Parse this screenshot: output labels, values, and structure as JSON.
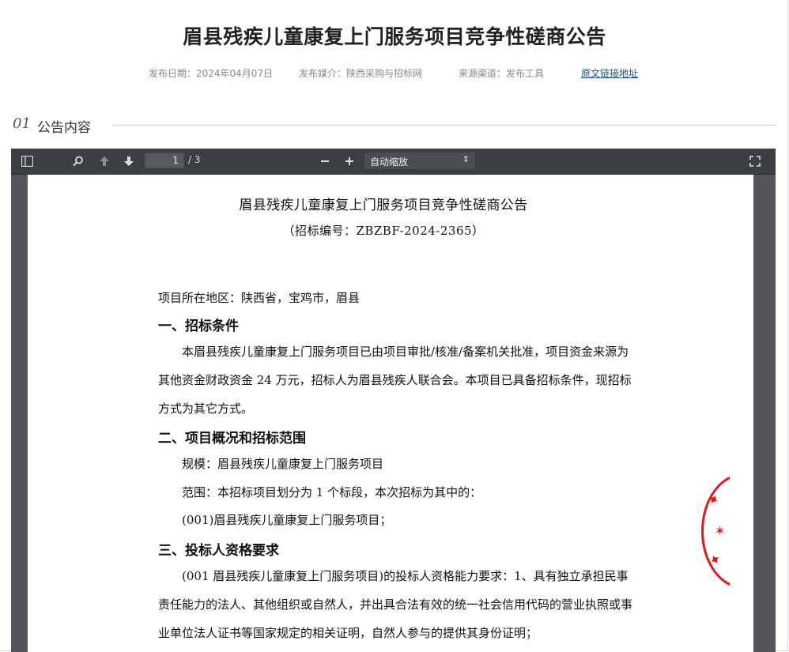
{
  "page": {
    "title": "眉县残疾儿童康复上门服务项目竞争性磋商公告",
    "meta": {
      "date": "发布日期：2024年04月07日",
      "media": "发布媒介：陕西采购与招标网",
      "source": "来源渠道：发布工具",
      "link": "原文链接地址"
    },
    "section": {
      "num": "01",
      "label": "公告内容"
    }
  },
  "viewer": {
    "page_current": "1",
    "page_total": "/ 3",
    "zoom_label": "自动缩放",
    "icons": [
      "sidebar-toggle-icon",
      "search-icon",
      "previous-page-icon",
      "next-page-icon",
      "zoom-out-icon",
      "zoom-in-icon",
      "fullscreen-icon"
    ]
  },
  "document": {
    "title": "眉县残疾儿童康复上门服务项目竞争性磋商公告",
    "subtitle": "（招标编号：ZBZBF-2024-2365）",
    "lines": [
      "项目所在地区：陕西省，宝鸡市，眉县",
      "一、招标条件",
      "本眉县残疾儿童康复上门服务项目已由项目审批/核准/备案机关批准，项目资金来源为",
      "其他资金财政资金 24 万元，招标人为眉县残疾人联合会。本项目已具备招标条件，现招标",
      "方式为其它方式。",
      "二、项目概况和招标范围",
      "规模：眉县残疾儿童康复上门服务项目",
      "范围：本招标项目划分为 1 个标段，本次招标为其中的：",
      "(001)眉县残疾儿童康复上门服务项目；",
      "三、投标人资格要求",
      "(001 眉县残疾儿童康复上门服务项目)的投标人资格能力要求：1、具有独立承担民事",
      "责任能力的法人、其他组织或自然人，并出具合法有效的统一社会信用代码的营业执照或事",
      "业单位法人证书等国家规定的相关证明，自然人参与的提供其身份证明；"
    ],
    "seal_color": "#e01a1a"
  }
}
